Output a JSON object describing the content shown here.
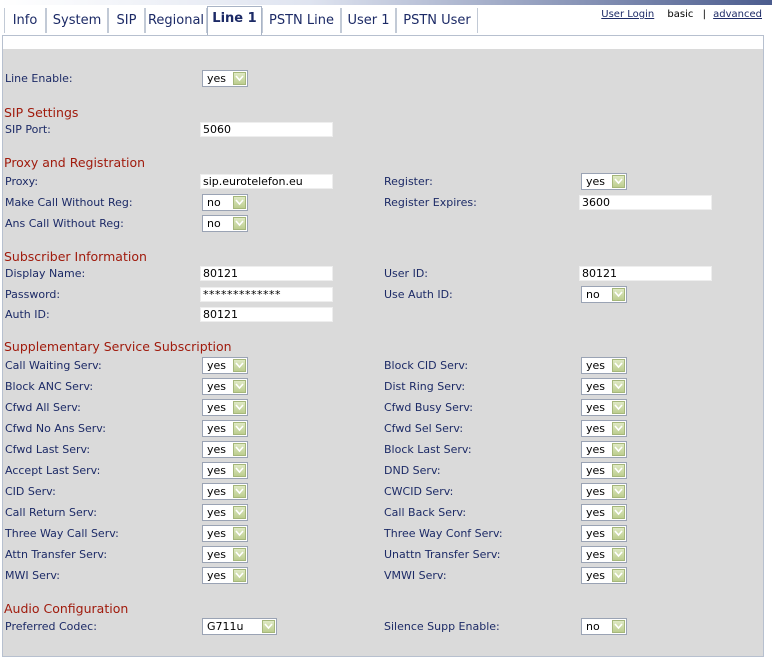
{
  "tabs": [
    "Info",
    "System",
    "SIP",
    "Regional",
    "Line 1",
    "PSTN Line",
    "User 1",
    "PSTN User"
  ],
  "active_tab": "Line 1",
  "top_links": {
    "user_login": "User Login",
    "basic": "basic",
    "separator": "|",
    "advanced": "advanced"
  },
  "line_enable": {
    "label": "Line Enable:",
    "value": "yes"
  },
  "sip_settings": {
    "heading": "SIP Settings",
    "sip_port": {
      "label": "SIP Port:",
      "value": "5060"
    }
  },
  "proxy_registration": {
    "heading": "Proxy and Registration",
    "proxy": {
      "label": "Proxy:",
      "value": "sip.eurotelefon.eu"
    },
    "register": {
      "label": "Register:",
      "value": "yes"
    },
    "make_call": {
      "label": "Make Call Without Reg:",
      "value": "no"
    },
    "register_expires": {
      "label": "Register Expires:",
      "value": "3600"
    },
    "ans_call": {
      "label": "Ans Call Without Reg:",
      "value": "no"
    }
  },
  "subscriber": {
    "heading": "Subscriber Information",
    "display_name": {
      "label": "Display Name:",
      "value": "80121"
    },
    "user_id": {
      "label": "User ID:",
      "value": "80121"
    },
    "password": {
      "label": "Password:",
      "value": "*************"
    },
    "use_auth_id": {
      "label": "Use Auth ID:",
      "value": "no"
    },
    "auth_id": {
      "label": "Auth ID:",
      "value": "80121"
    }
  },
  "supplementary": {
    "heading": "Supplementary Service Subscription",
    "rows": [
      {
        "l_label": "Call Waiting Serv:",
        "l_value": "yes",
        "r_label": "Block CID Serv:",
        "r_value": "yes"
      },
      {
        "l_label": "Block ANC Serv:",
        "l_value": "yes",
        "r_label": "Dist Ring Serv:",
        "r_value": "yes"
      },
      {
        "l_label": "Cfwd All Serv:",
        "l_value": "yes",
        "r_label": "Cfwd Busy Serv:",
        "r_value": "yes"
      },
      {
        "l_label": "Cfwd No Ans Serv:",
        "l_value": "yes",
        "r_label": "Cfwd Sel Serv:",
        "r_value": "yes"
      },
      {
        "l_label": "Cfwd Last Serv:",
        "l_value": "yes",
        "r_label": "Block Last Serv:",
        "r_value": "yes"
      },
      {
        "l_label": "Accept Last Serv:",
        "l_value": "yes",
        "r_label": "DND Serv:",
        "r_value": "yes"
      },
      {
        "l_label": "CID Serv:",
        "l_value": "yes",
        "r_label": "CWCID Serv:",
        "r_value": "yes"
      },
      {
        "l_label": "Call Return Serv:",
        "l_value": "yes",
        "r_label": "Call Back Serv:",
        "r_value": "yes"
      },
      {
        "l_label": "Three Way Call Serv:",
        "l_value": "yes",
        "r_label": "Three Way Conf Serv:",
        "r_value": "yes"
      },
      {
        "l_label": "Attn Transfer Serv:",
        "l_value": "yes",
        "r_label": "Unattn Transfer Serv:",
        "r_value": "yes"
      },
      {
        "l_label": "MWI Serv:",
        "l_value": "yes",
        "r_label": "VMWI Serv:",
        "r_value": "yes"
      }
    ]
  },
  "audio": {
    "heading": "Audio Configuration",
    "preferred_codec": {
      "label": "Preferred Codec:",
      "value": "G711u"
    },
    "silence_supp": {
      "label": "Silence Supp Enable:",
      "value": "no"
    }
  },
  "colors": {
    "label": "#1c2a66",
    "section": "#a01b0d",
    "background": "#dadada",
    "select_button": "#c8d89c"
  }
}
